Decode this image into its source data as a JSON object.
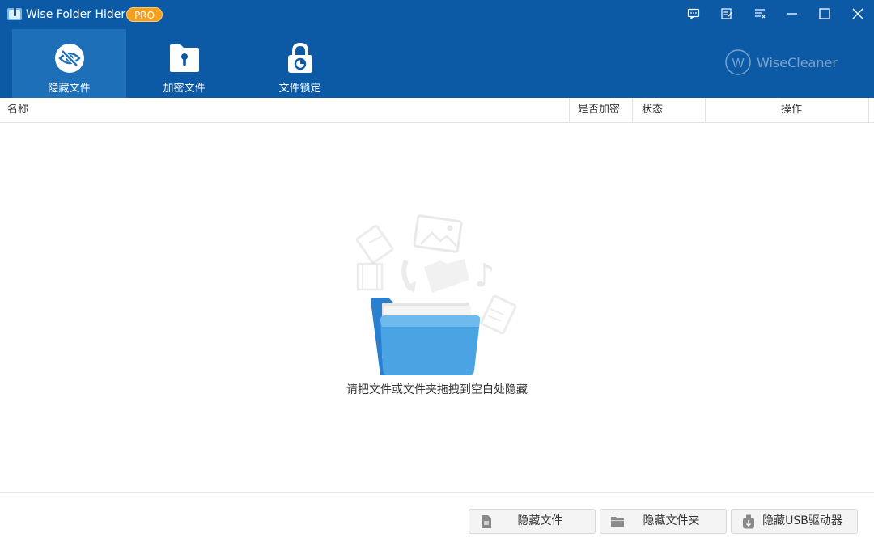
{
  "app": {
    "title": "Wise Folder Hider",
    "badge": "PRO"
  },
  "titlebar_buttons": [
    "feedback-icon",
    "notes-icon",
    "menu-icon",
    "minimize-icon",
    "maximize-icon",
    "close-icon"
  ],
  "nav": {
    "tabs": [
      {
        "label": "隐藏文件",
        "icon": "eye-slash-icon",
        "active": true
      },
      {
        "label": "加密文件",
        "icon": "folder-keyhole-icon",
        "active": false
      },
      {
        "label": "文件锁定",
        "icon": "padlock-icon",
        "active": false
      }
    ]
  },
  "brand": {
    "mark": "W",
    "name": "WiseCleaner"
  },
  "table": {
    "columns": [
      "名称",
      "是否加密",
      "状态",
      "操作"
    ]
  },
  "empty_state": {
    "message": "请把文件或文件夹拖拽到空白处隐藏"
  },
  "actions": [
    {
      "label": "隐藏文件",
      "icon": "file-icon"
    },
    {
      "label": "隐藏文件夹",
      "icon": "folder-icon"
    },
    {
      "label": "隐藏USB驱动器",
      "icon": "usb-drive-icon"
    }
  ],
  "colors": {
    "header": "#0c5aa6",
    "active_tab": "#1d6fb8",
    "badge": "#f5a020",
    "folder": "#4aa3e3"
  }
}
